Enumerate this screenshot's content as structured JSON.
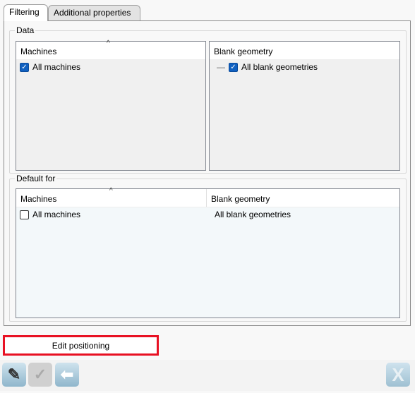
{
  "tabs": [
    {
      "label": "Filtering",
      "active": true
    },
    {
      "label": "Additional properties",
      "active": false
    }
  ],
  "data_group": {
    "title": "Data",
    "machines": {
      "header": "Machines",
      "items": [
        {
          "label": "All machines",
          "checked": true
        }
      ]
    },
    "blank_geometry": {
      "header": "Blank geometry",
      "items": [
        {
          "label": "All blank geometries",
          "checked": true
        }
      ]
    }
  },
  "default_group": {
    "title": "Default for",
    "columns": [
      "Machines",
      "Blank geometry"
    ],
    "rows": [
      {
        "machine": "All machines",
        "blank_geometry": "All blank geometries",
        "checked": false
      }
    ]
  },
  "edit_positioning_label": "Edit positioning",
  "toolbar": {
    "buttons": [
      "pencil-icon",
      "check-icon",
      "back-arrow-icon",
      "close-x-icon"
    ]
  },
  "colors": {
    "highlight": "#e81123",
    "checkbox": "#1060c0"
  }
}
